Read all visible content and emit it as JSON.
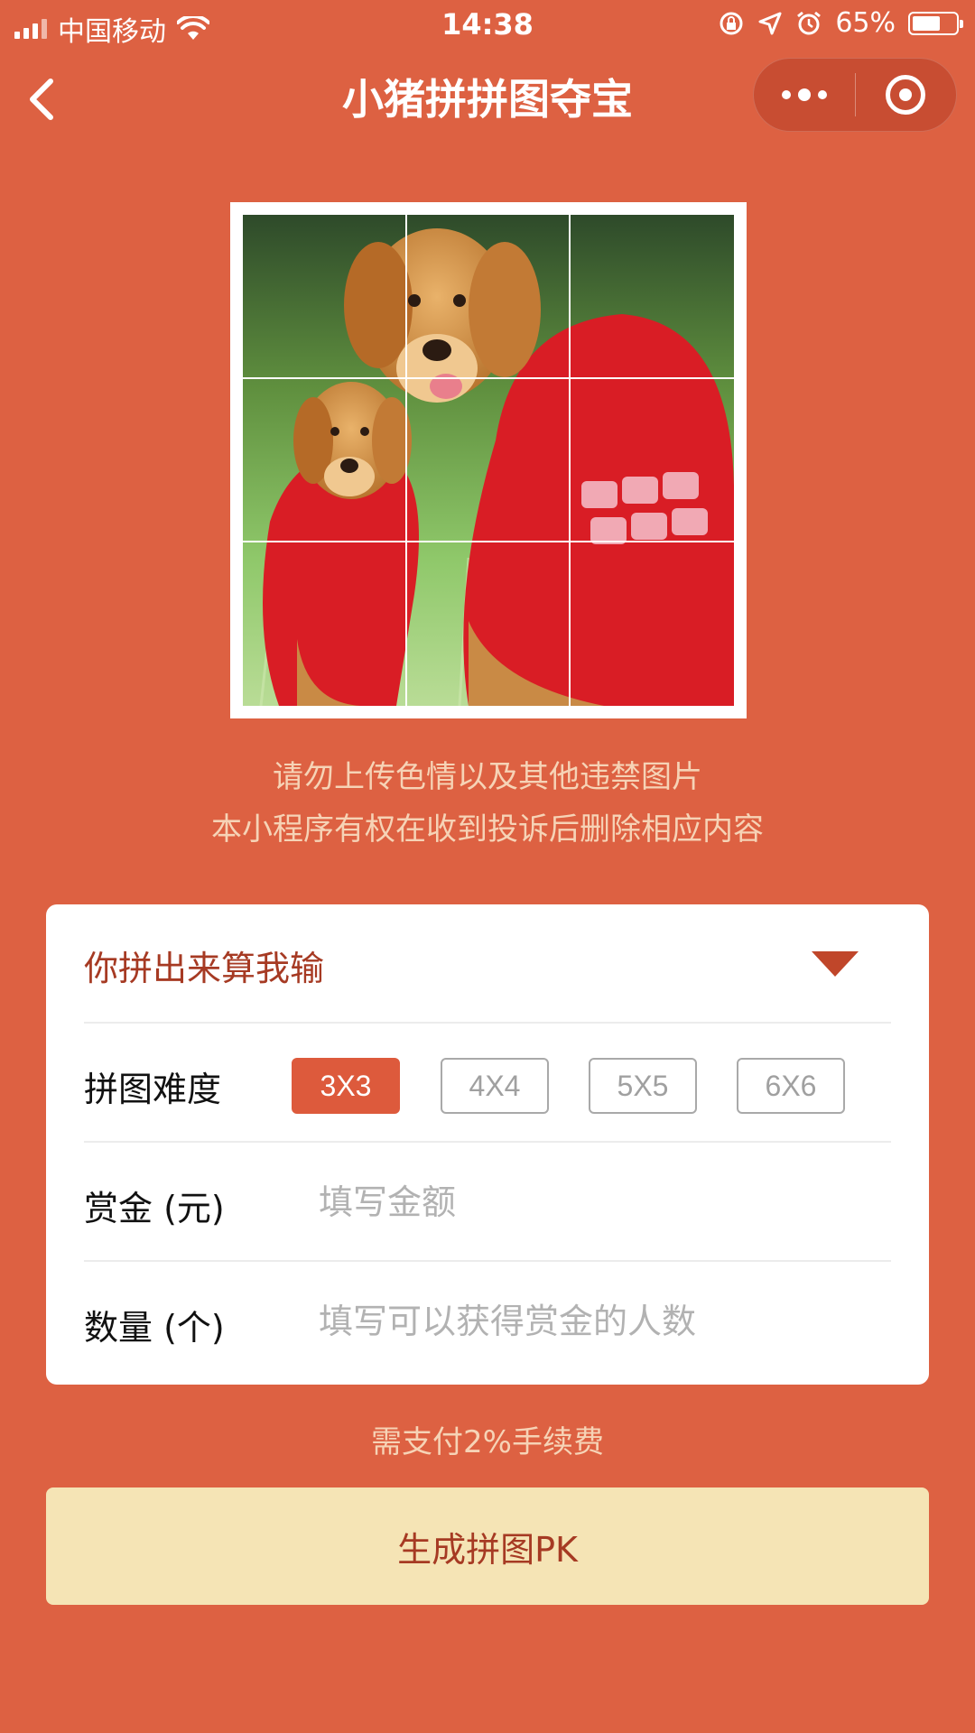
{
  "status_bar": {
    "carrier": "中国移动",
    "time": "14:38",
    "battery": "65%",
    "battery_level": 0.65,
    "icons": [
      "signal-icon",
      "wifi-icon",
      "rotation-lock-icon",
      "location-icon",
      "alarm-icon",
      "battery-icon"
    ]
  },
  "nav": {
    "title": "小猪拼拼图夺宝",
    "back_icon": "chevron-left-icon",
    "more_icon": "more-dots-icon",
    "close_icon": "target-circle-icon"
  },
  "puzzle": {
    "grid": "3x3"
  },
  "notice": {
    "line1": "请勿上传色情以及其他违禁图片",
    "line2": "本小程序有权在收到投诉后删除相应内容"
  },
  "form": {
    "mode": {
      "selected": "你拼出来算我输"
    },
    "difficulty": {
      "label": "拼图难度",
      "options": [
        "3X3",
        "4X4",
        "5X5",
        "6X6"
      ],
      "selected": "3X3"
    },
    "bounty": {
      "label": "赏金 (元)",
      "placeholder": "填写金额",
      "value": ""
    },
    "count": {
      "label": "数量 (个)",
      "placeholder": "填写可以获得赏金的人数",
      "value": ""
    }
  },
  "fee_note": "需支付2%手续费",
  "submit_label": "生成拼图PK",
  "colors": {
    "background": "#dd6142",
    "accent": "#dd5a3c",
    "button_bg": "#f5e4b5",
    "button_text": "#a63a23",
    "notice_text": "#f6d3b6"
  }
}
